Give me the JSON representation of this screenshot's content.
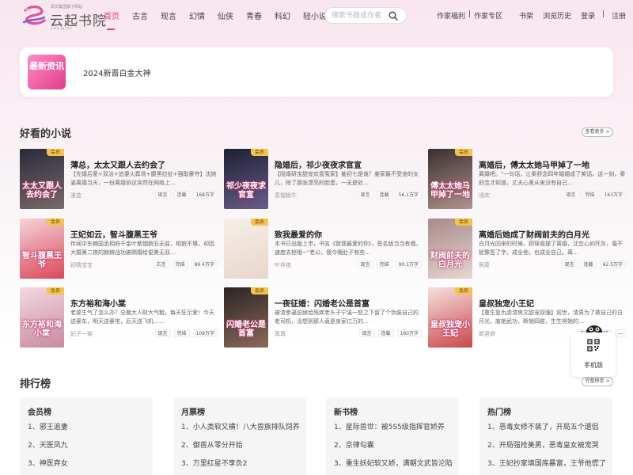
{
  "brand": {
    "name": "云起书院",
    "slogan": "阅文集团旗下网站",
    "domain": "yunqi.qq.com"
  },
  "nav": [
    "首页",
    "古言",
    "现言",
    "幻情",
    "仙侠",
    "青春",
    "科幻",
    "轻小说"
  ],
  "search": {
    "placeholder": "搜索书籍或作者"
  },
  "topright": [
    "作家福利",
    "|",
    "作家专区",
    "书架",
    "浏览历史",
    "登录",
    "|",
    "注册"
  ],
  "news": {
    "badge": "最新资讯",
    "text": "2024新晋白金大神"
  },
  "good_books": {
    "title": "好看的小说",
    "more": "查看更多 >",
    "vip_label": "会员",
    "items": [
      {
        "title": "薄总，太太又跟人去约会了",
        "desc": "【先婚后爱+双洁+追妻火葬场+腹黑拉扯+强取豪夺】沈婉姿离婚当天，一份离婚协议突然在网络上…",
        "author": "淮芸",
        "tags": [
          "现言",
          "连载",
          "168万字"
        ],
        "cover_text": "太太又跟人去约会了",
        "cover_colors": [
          "#2a2a3a",
          "#7a6a6a"
        ]
      },
      {
        "title": "隐婚后，祁少夜夜求官宣",
        "desc": "【隐婚研宝甜宠欢喜冤家】姜初七是谁？姜家最不受宠的女儿，除了那张漂亮的脸蛋，一无是处…",
        "author": "蒸馏桃牛",
        "tags": [
          "现言",
          "连载",
          "56.1万字"
        ],
        "cover_text": "祁少夜夜求官宣",
        "cover_colors": [
          "#1c1f33",
          "#6a5c8a"
        ]
      },
      {
        "title": "离婚后，傅太太她马甲掉了一地",
        "desc": "离婚吧。\"一句话，让秦舒念四年婚姻成了笑话。这一刻，秦舒念才知道，丈夫心里从来没有自己…",
        "author": "浅欢",
        "tags": [
          "现言",
          "完结",
          "163万字"
        ],
        "cover_text": "傅太太她马甲掉了一地",
        "cover_colors": [
          "#3a3030",
          "#b0938a"
        ]
      },
      {
        "title": "王妃如云，智斗腹黑王爷",
        "desc": "传闻中东楠国丞相府千金叶紫烟貌丑无盐，相貌不堪，却因大婚第二夜的赫赫战功被赐婚给俊美无双…",
        "author": "初晴宝宝",
        "tags": [
          "古言",
          "完结",
          "86.4万字"
        ],
        "cover_text": "智斗腹黑王爷",
        "cover_colors": [
          "#f5d3d8",
          "#d9485b"
        ]
      },
      {
        "title": "致我最爱的你",
        "desc": "本书已出版上市，书名《致我最爱的你》，签名版当当有哦，速度去抢哦~\"老公，我今晚肚子有些…",
        "author": "叶非夜",
        "tags": [
          "现言",
          "完结",
          "90.1万字"
        ],
        "cover_text": "",
        "cover_colors": [
          "#f6efe8",
          "#e8d6ca"
        ]
      },
      {
        "title": "离婚后她成了财阀前夫的白月光",
        "desc": "白月光回来的时候，顾琛竟提了离婚，沈恋心如死灰，毫不犹豫签了字，成全他，也成全自己。离…",
        "author": "照菜",
        "tags": [
          "现言",
          "连载",
          "62.5万字"
        ],
        "cover_text": "财阀前夫的白月光",
        "cover_colors": [
          "#a88a8a",
          "#e6d6d2"
        ]
      },
      {
        "title": "东方裕和海小棠",
        "desc": "老婆生气了怎么办？总裁大人财大气粗，每天狂示爱！今天送豪车，明天送豪宅，后天送飞机……",
        "author": "妃子一笑",
        "tags": [
          "现言",
          "完结",
          "109万字"
        ],
        "cover_text": "东方裕和海小棠",
        "cover_colors": [
          "#f3d8e0",
          "#c88aa2"
        ]
      },
      {
        "title": "一夜征婚：闪婚老公是首富",
        "desc": "被渣爹逼迫嫁给残疾老头子宁溪一怒之下留了个伪装自己的老司机，没想到那人竟是身家亿万的…",
        "author": "苒苒",
        "tags": [
          "现言",
          "连载",
          "160万字"
        ],
        "cover_text": "闪婚老公是首富",
        "cover_colors": [
          "#2b2424",
          "#8a6a5a"
        ]
      },
      {
        "title": "皇叔独宠小王妃",
        "desc": "【重生复仇虐渣爽文甜宠双强】前世，渣男为了救自己的白月光，废她武功，断她四肢，生生将她的…",
        "author": "断君卿",
        "tags": [
          "古言",
          "完结",
          "—"
        ],
        "cover_text": "皇叔独宠小王妃",
        "cover_colors": [
          "#f6e0e0",
          "#c8484a"
        ]
      }
    ]
  },
  "ranking": {
    "title": "排行榜",
    "more": "完整榜单 >",
    "boards": [
      {
        "title": "会员榜",
        "items": [
          "1、邪王追妻",
          "2、天医凤九",
          "3、神医弃女"
        ]
      },
      {
        "title": "月票榜",
        "items": [
          "1、小人类软又横！八大兽族排队饲养",
          "2、御兽从零分开始",
          "3、万里红星不享负2"
        ]
      },
      {
        "title": "新书榜",
        "items": [
          "1、星际兽世：被5S5级指挥官娇养",
          "2、京律勾囊",
          "3、重生妖妃软又娇，满朝文武皆沦陷"
        ]
      },
      {
        "title": "热门榜",
        "items": [
          "1、恶毒女修不装了，开局五个遗侣",
          "2、开局强抢美男，恶毒皇女被宠哭",
          "3、王妃抄家填国库暴富，王爷他慌了"
        ]
      }
    ]
  },
  "mobile": {
    "label": "手机版"
  },
  "colors": {
    "accent": "#e83e8c",
    "vip": "#f3c44b"
  }
}
